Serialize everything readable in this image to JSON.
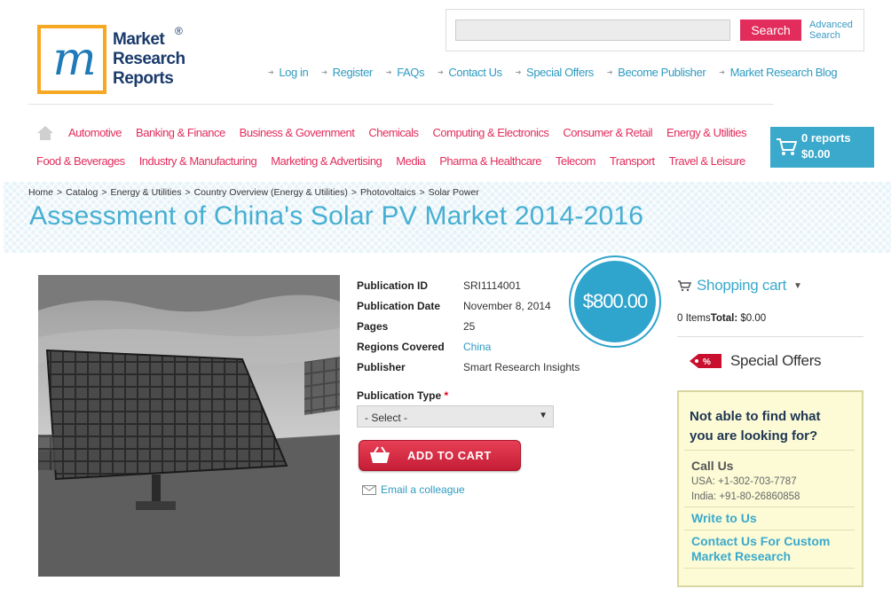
{
  "logo": {
    "letter": "m",
    "line1": "Market",
    "line2": "Research",
    "line3": "Reports",
    "reg": "®"
  },
  "search": {
    "placeholder": "",
    "button": "Search",
    "advanced_line1": "Advanced",
    "advanced_line2": "Search"
  },
  "top_links": [
    "Log in",
    "Register",
    "FAQs",
    "Contact Us",
    "Special Offers",
    "Become Publisher",
    "Market Research Blog"
  ],
  "nav_row1": [
    "Automotive",
    "Banking & Finance",
    "Business & Government",
    "Chemicals",
    "Computing & Electronics",
    "Consumer & Retail",
    "Energy & Utilities"
  ],
  "nav_row2": [
    "Food & Beverages",
    "Industry & Manufacturing",
    "Marketing & Advertising",
    "Media",
    "Pharma & Healthcare",
    "Telecom",
    "Transport",
    "Travel & Leisure"
  ],
  "cart": {
    "reports": "0 reports",
    "amount": "$0.00"
  },
  "breadcrumb": [
    "Home",
    "Catalog",
    "Energy & Utilities",
    "Country Overview (Energy & Utilities)",
    "Photovoltaics",
    "Solar Power"
  ],
  "page_title": "Assessment of China's Solar PV Market 2014-2016",
  "details": [
    {
      "label": "Publication ID",
      "value": "SRI1114001",
      "link": false
    },
    {
      "label": "Publication Date",
      "value": "November 8, 2014",
      "link": false
    },
    {
      "label": "Pages",
      "value": "25",
      "link": false
    },
    {
      "label": "Regions Covered",
      "value": "China",
      "link": true
    },
    {
      "label": "Publisher",
      "value": "Smart Research Insights",
      "link": false
    }
  ],
  "price": "$800.00",
  "publication_type": {
    "label": "Publication Type",
    "required": "*",
    "selected": "- Select -"
  },
  "add_to_cart": "ADD TO CART",
  "email_colleague": "Email a colleague",
  "shopping_cart": {
    "title": "Shopping cart",
    "items": "0 Items",
    "total_label": "Total:",
    "total_value": "$0.00"
  },
  "special_offers": "Special Offers",
  "help": {
    "title_line1": "Not able to find what",
    "title_line2": "you are looking for?",
    "call_us": "Call Us",
    "usa": "USA: +1-302-703-7787",
    "india": "India: +91-80-26860858",
    "write": "Write to Us",
    "custom_line1": "Contact Us For Custom",
    "custom_line2": "Market Research"
  },
  "colors": {
    "accent_blue": "#3aa9cc",
    "accent_pink": "#e22d5c",
    "logo_orange": "#f7a823",
    "logo_navy": "#1a3a6b"
  }
}
